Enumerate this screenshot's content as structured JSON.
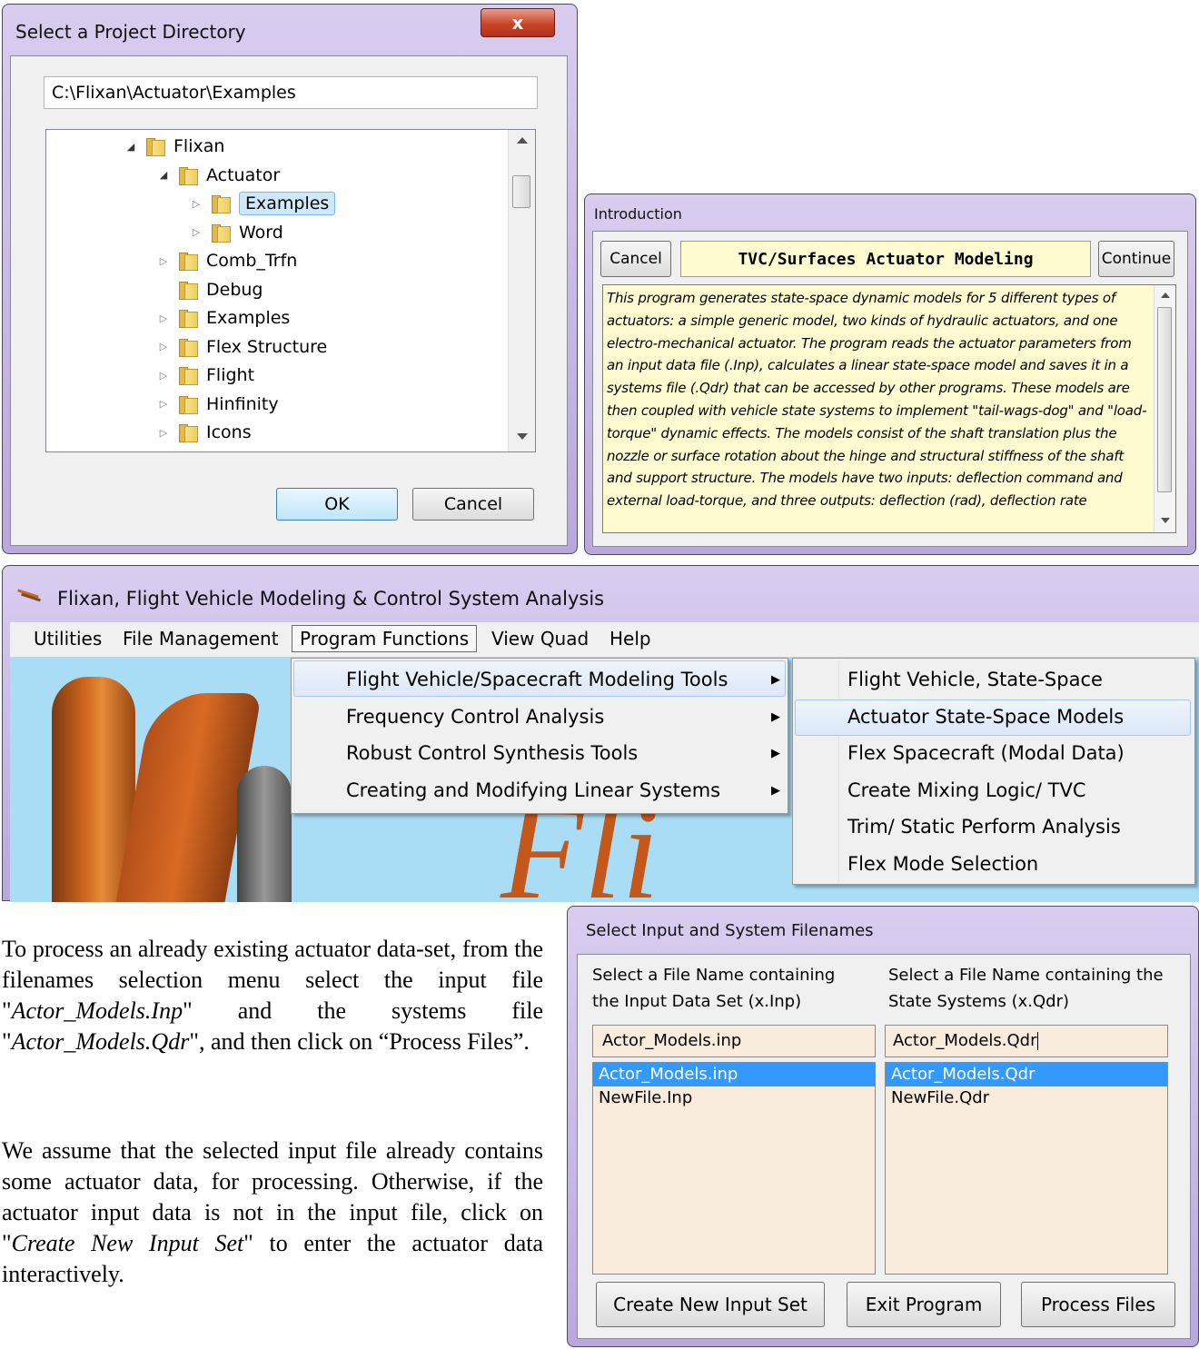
{
  "dir_dialog": {
    "title": "Select a Project Directory",
    "close_glyph": "x",
    "path": "C:\\Flixan\\Actuator\\Examples",
    "tree": [
      {
        "label": "Flixan",
        "expander": "open"
      },
      {
        "label": "Actuator",
        "expander": "open"
      },
      {
        "label": "Examples",
        "expander": "closed",
        "selected": true
      },
      {
        "label": "Word",
        "expander": "closed"
      },
      {
        "label": "Comb_Trfn",
        "expander": "closed"
      },
      {
        "label": "Debug",
        "expander": "none"
      },
      {
        "label": "Examples",
        "expander": "closed"
      },
      {
        "label": "Flex Structure",
        "expander": "closed"
      },
      {
        "label": "Flight",
        "expander": "closed"
      },
      {
        "label": "Hinfinity",
        "expander": "closed"
      },
      {
        "label": "Icons",
        "expander": "closed"
      }
    ],
    "ok_label": "OK",
    "cancel_label": "Cancel"
  },
  "intro_dialog": {
    "title": "Introduction",
    "cancel_label": "Cancel",
    "heading": "TVC/Surfaces Actuator Modeling",
    "continue_label": "Continue",
    "text": "This program generates state-space dynamic models for 5 different types of actuators: a simple generic model, two kinds of hydraulic actuators, and one electro-mechanical actuator. The program reads the actuator parameters from an input data file (.Inp), calculates a linear state-space model and saves it in a systems file (.Qdr) that can be accessed by other programs. These models are then coupled with vehicle state systems to implement \"tail-wags-dog\" and \"load-torque\" dynamic effects. The models consist of the shaft translation plus the nozzle or surface rotation about the hinge and structural stiffness of the shaft and support structure. The models have two inputs: deflection command and external load-torque, and three outputs: deflection (rad), deflection rate"
  },
  "main_window": {
    "title": "Flixan, Flight Vehicle Modeling & Control System Analysis",
    "menubar": [
      "Utilities",
      "File Management",
      "Program Functions",
      "View Quad",
      "Help"
    ],
    "menu_items": [
      "Flight Vehicle/Spacecraft Modeling Tools",
      "Frequency Control Analysis",
      "Robust Control Synthesis Tools",
      "Creating and Modifying Linear Systems"
    ],
    "submenu_items": [
      "Flight Vehicle, State-Space",
      "Actuator State-Space Models",
      "Flex Spacecraft (Modal Data)",
      "Create Mixing Logic/ TVC",
      "Trim/ Static Perform Analysis",
      "Flex Mode Selection"
    ],
    "colors": {
      "sky": "#a9dcf5",
      "rocket": "#c4571a"
    }
  },
  "files_dialog": {
    "title": "Select Input and System Filenames",
    "left_header": "Select a File Name containing the Input Data Set (x.Inp)",
    "right_header": "Select a File Name containing the State Systems (x.Qdr)",
    "left_value": "Actor_Models.inp",
    "right_value": "Actor_Models.Qdr",
    "left_list": [
      "Actor_Models.inp",
      "NewFile.Inp"
    ],
    "right_list": [
      "Actor_Models.Qdr",
      "NewFile.Qdr"
    ],
    "create_label": "Create New Input Set",
    "exit_label": "Exit Program",
    "process_label": "Process Files"
  },
  "prose": {
    "p1_a": "To process an already existing actuator data-set, from the filenames selection menu select the input file \"",
    "p1_b": "Actor_Models.Inp",
    "p1_c": "\" and the systems file \"",
    "p1_d": "Actor_Models.Qdr",
    "p1_e": "\", and then click on “Process Files”.",
    "p2_a": "We assume that the selected input file already contains some actuator data, for processing. Otherwise, if the actuator input data is not in the input file, click on \"",
    "p2_b": "Create New Input Set",
    "p2_c": "\" to enter the actuator data interactively."
  }
}
